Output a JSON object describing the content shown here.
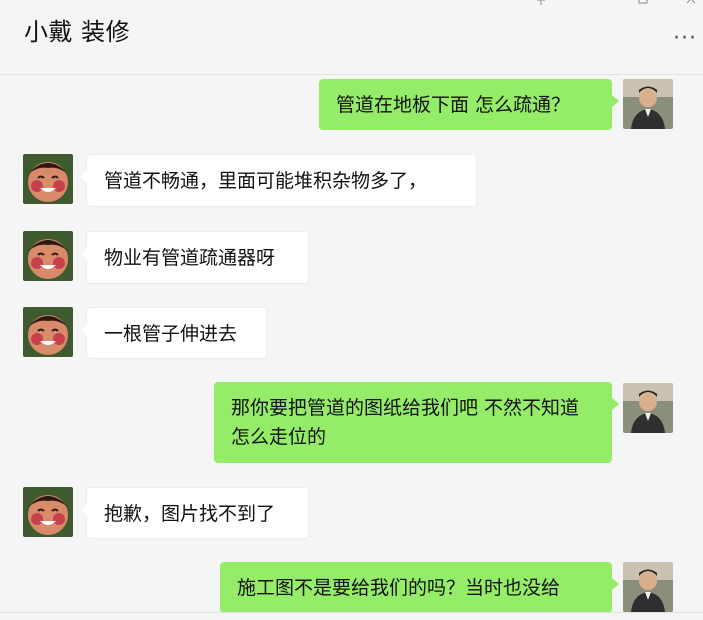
{
  "chat": {
    "title": "小戴 装修",
    "more_icon": "more-dots-icon",
    "window_icons": [
      "pin-icon",
      "minimize-icon",
      "maximize-icon",
      "close-icon"
    ]
  },
  "messages": [
    {
      "side": "out",
      "text": "管道在地板下面 怎么疏通？"
    },
    {
      "side": "in",
      "text": "管道不畅通，里面可能堆积杂物多了，"
    },
    {
      "side": "in",
      "text": "物业有管道疏通器呀"
    },
    {
      "side": "in",
      "text": "一根管子伸进去"
    },
    {
      "side": "out",
      "text": "那你要把管道的图纸给我们吧 不然不知道怎么走位的"
    },
    {
      "side": "in",
      "text": "抱歉，图片找不到了"
    },
    {
      "side": "out",
      "text": "施工图不是要给我们的吗？当时也没给"
    }
  ],
  "colors": {
    "outgoing_bubble": "#95ec69",
    "incoming_bubble": "#ffffff",
    "background": "#f5f5f5"
  }
}
